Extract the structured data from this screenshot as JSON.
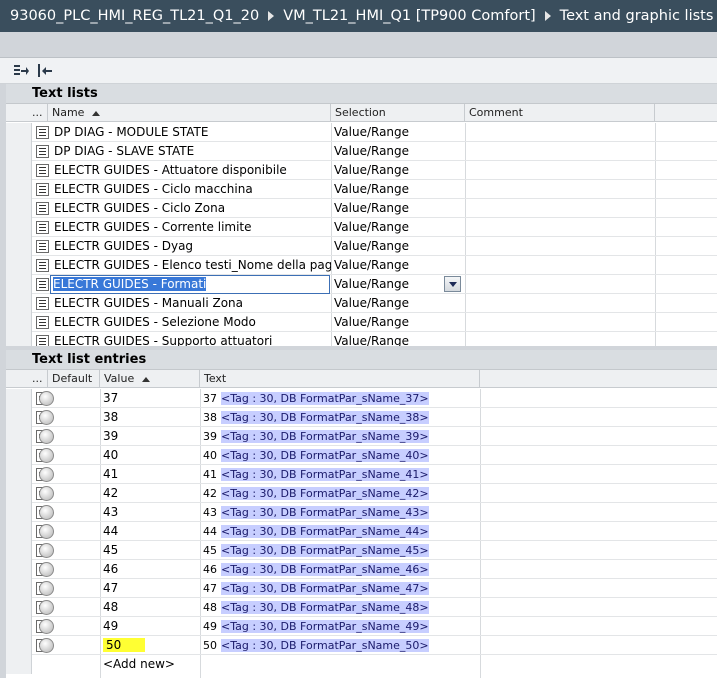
{
  "breadcrumb": [
    "93060_PLC_HMI_REG_TL21_Q1_20",
    "VM_TL21_HMI_Q1 [TP900 Comfort]",
    "Text and graphic lists"
  ],
  "toolbar": {
    "expand_icon": "expand-rows-icon",
    "collapse_icon": "collapse-rows-icon"
  },
  "text_lists": {
    "title": "Text lists",
    "columns": {
      "sel": "...",
      "name": "Name",
      "selection": "Selection",
      "comment": "Comment"
    },
    "rows": [
      {
        "name": "DP DIAG - MODULE STATE",
        "selection": "Value/Range",
        "comment": ""
      },
      {
        "name": "DP DIAG - SLAVE STATE",
        "selection": "Value/Range",
        "comment": ""
      },
      {
        "name": "ELECTR GUIDES - Attuatore disponibile",
        "selection": "Value/Range",
        "comment": ""
      },
      {
        "name": "ELECTR GUIDES - Ciclo macchina",
        "selection": "Value/Range",
        "comment": ""
      },
      {
        "name": "ELECTR GUIDES - Ciclo Zona",
        "selection": "Value/Range",
        "comment": ""
      },
      {
        "name": "ELECTR GUIDES - Corrente limite",
        "selection": "Value/Range",
        "comment": ""
      },
      {
        "name": "ELECTR GUIDES - Dyag",
        "selection": "Value/Range",
        "comment": ""
      },
      {
        "name": "ELECTR GUIDES - Elenco testi_Nome della pagina",
        "selection": "Value/Range",
        "comment": ""
      },
      {
        "name": "ELECTR GUIDES - Formati",
        "selection": "Value/Range",
        "comment": "",
        "editing": true
      },
      {
        "name": "ELECTR GUIDES - Manuali Zona",
        "selection": "Value/Range",
        "comment": ""
      },
      {
        "name": "ELECTR GUIDES - Selezione Modo",
        "selection": "Value/Range",
        "comment": ""
      },
      {
        "name": "ELECTR GUIDES - Supporto attuatori",
        "selection": "Value/Range",
        "comment": ""
      }
    ]
  },
  "entries": {
    "title": "Text list entries",
    "columns": {
      "sel": "...",
      "default": "Default",
      "value": "Value",
      "text": "Text"
    },
    "rows": [
      {
        "value": "37",
        "prefix": "37",
        "tag": "<Tag : 30, DB FormatPar_sName_37>"
      },
      {
        "value": "38",
        "prefix": "38",
        "tag": "<Tag : 30, DB FormatPar_sName_38>"
      },
      {
        "value": "39",
        "prefix": "39",
        "tag": "<Tag : 30, DB FormatPar_sName_39>"
      },
      {
        "value": "40",
        "prefix": "40",
        "tag": "<Tag : 30, DB FormatPar_sName_40>"
      },
      {
        "value": "41",
        "prefix": "41",
        "tag": "<Tag : 30, DB FormatPar_sName_41>"
      },
      {
        "value": "42",
        "prefix": "42",
        "tag": "<Tag : 30, DB FormatPar_sName_42>"
      },
      {
        "value": "43",
        "prefix": "43",
        "tag": "<Tag : 30, DB FormatPar_sName_43>"
      },
      {
        "value": "44",
        "prefix": "44",
        "tag": "<Tag : 30, DB FormatPar_sName_44>"
      },
      {
        "value": "45",
        "prefix": "45",
        "tag": "<Tag : 30, DB FormatPar_sName_45>"
      },
      {
        "value": "46",
        "prefix": "46",
        "tag": "<Tag : 30, DB FormatPar_sName_46>"
      },
      {
        "value": "47",
        "prefix": "47",
        "tag": "<Tag : 30, DB FormatPar_sName_47>"
      },
      {
        "value": "48",
        "prefix": "48",
        "tag": "<Tag : 30, DB FormatPar_sName_48>"
      },
      {
        "value": "49",
        "prefix": "49",
        "tag": "<Tag : 30, DB FormatPar_sName_49>"
      },
      {
        "value": "50",
        "prefix": "50",
        "tag": "<Tag : 30, DB FormatPar_sName_50>",
        "highlight": true
      }
    ],
    "add_new": "<Add new>"
  },
  "colors": {
    "title_bar": "#3a4e5d",
    "tag_highlight": "#c7ceff",
    "value_highlight": "#ffff33",
    "edit_selection": "#3878d8"
  }
}
